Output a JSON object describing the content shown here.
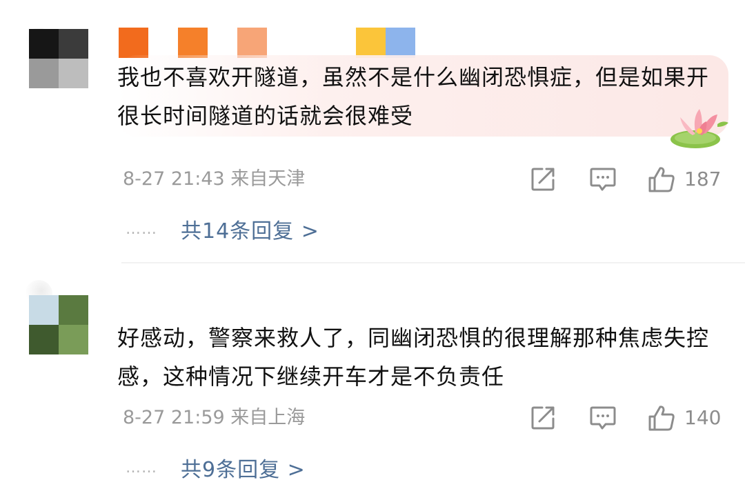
{
  "colors": {
    "text": "#111111",
    "meta": "#9a9a9a",
    "link": "#4e6f96",
    "divider": "#f1f1f1",
    "bubble": "#fce8e6"
  },
  "comments": [
    {
      "name_colors": [
        "#f26b1d",
        "#f5802a",
        "#f7a577",
        "#fbc53a",
        "#8db4ec"
      ],
      "avatar_colors": [
        "#161616",
        "#3b3b3b",
        "#9a9a9a",
        "#bdbdbd"
      ],
      "text": "我也不喜欢开隧道，虽然不是什么幽闭恐惧症，但是如果开很长时间隧道的话就会很难受",
      "has_badge_bubble": true,
      "timestamp": "8-27 21:43 来自天津",
      "likes": "187",
      "replies": "共14条回复 >",
      "dots": "……",
      "icons": {
        "share": "share-icon",
        "comment": "comment-icon",
        "like": "thumbs-up-icon"
      }
    },
    {
      "avatar_colors": [
        "#c8dbe6",
        "#5a7a40",
        "#3f5a2e",
        "#7a9c58"
      ],
      "text": "好感动，警察来救人了，同幽闭恐惧的很理解那种焦虑失控感，这种情况下继续开车才是不负责任",
      "timestamp": "8-27 21:59 来自上海",
      "likes": "140",
      "replies": "共9条回复 >",
      "dots": "……",
      "icons": {
        "share": "share-icon",
        "comment": "comment-icon",
        "like": "thumbs-up-icon"
      }
    }
  ]
}
